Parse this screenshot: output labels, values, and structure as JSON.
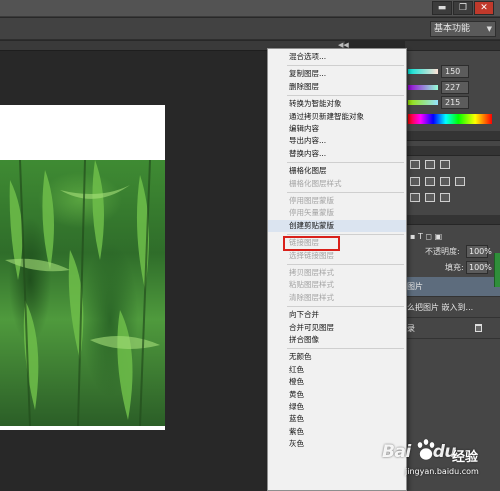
{
  "window": {
    "minimize": "▬",
    "restore": "❐",
    "close": "✕"
  },
  "options_bar": {
    "workspace": "基本功能"
  },
  "color_panel": {
    "r": "150",
    "g": "227",
    "b": "215",
    "r_color": "#96e3d7",
    "g_color": "#96e3d7"
  },
  "layers_panel": {
    "opacity_label": "不透明度:",
    "opacity_value": "100%",
    "fill_label": "填充:",
    "fill_value": "100%",
    "layers": [
      {
        "name": "图片",
        "selected": true
      },
      {
        "name": "么把图片 嵌入到...",
        "selected": false
      },
      {
        "name": "录",
        "selected": false
      }
    ]
  },
  "context_menu": {
    "items": [
      {
        "label": "混合选项...",
        "disabled": false
      },
      {
        "sep": true
      },
      {
        "label": "复制图层...",
        "disabled": false
      },
      {
        "label": "删除图层",
        "disabled": false
      },
      {
        "sep": true
      },
      {
        "label": "转换为智能对象",
        "disabled": false
      },
      {
        "label": "通过拷贝新建智能对象",
        "disabled": false
      },
      {
        "label": "编辑内容",
        "disabled": false
      },
      {
        "label": "导出内容...",
        "disabled": false
      },
      {
        "label": "替换内容...",
        "disabled": false
      },
      {
        "sep": true
      },
      {
        "label": "栅格化图层",
        "disabled": false
      },
      {
        "label": "栅格化图层样式",
        "disabled": true
      },
      {
        "sep": true
      },
      {
        "label": "停用图层蒙版",
        "disabled": true
      },
      {
        "label": "停用矢量蒙版",
        "disabled": true
      },
      {
        "label": "创建剪贴蒙版",
        "disabled": false,
        "highlighted": true
      },
      {
        "sep": true
      },
      {
        "label": "链接图层",
        "disabled": true
      },
      {
        "label": "选择链接图层",
        "disabled": true
      },
      {
        "sep": true
      },
      {
        "label": "拷贝图层样式",
        "disabled": true
      },
      {
        "label": "粘贴图层样式",
        "disabled": true
      },
      {
        "label": "清除图层样式",
        "disabled": true
      },
      {
        "sep": true
      },
      {
        "label": "向下合并",
        "disabled": false
      },
      {
        "label": "合并可见图层",
        "disabled": false
      },
      {
        "label": "拼合图像",
        "disabled": false
      },
      {
        "sep": true
      },
      {
        "label": "无颜色",
        "disabled": false
      },
      {
        "label": "红色",
        "disabled": false
      },
      {
        "label": "橙色",
        "disabled": false
      },
      {
        "label": "黄色",
        "disabled": false
      },
      {
        "label": "绿色",
        "disabled": false
      },
      {
        "label": "蓝色",
        "disabled": false
      },
      {
        "label": "紫色",
        "disabled": false
      },
      {
        "label": "灰色",
        "disabled": false
      }
    ]
  },
  "watermark": {
    "brand_a": "Bai",
    "brand_b": "du",
    "jingyan": "经验",
    "url": "jingyan.baidu.com"
  }
}
